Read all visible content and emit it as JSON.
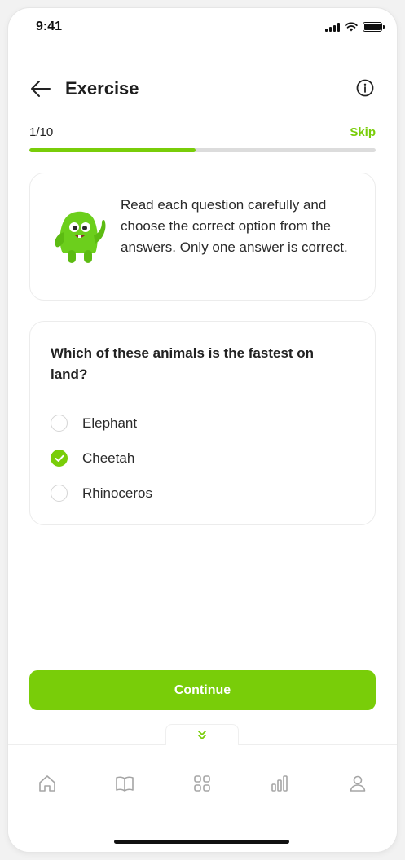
{
  "status_bar": {
    "time": "9:41"
  },
  "header": {
    "title": "Exercise"
  },
  "progress": {
    "count_text": "1/10",
    "skip_label": "Skip",
    "fraction": 0.48
  },
  "instruction": {
    "text": "Read each question carefully and choose the correct option from the answers. Only one answer is correct."
  },
  "question": {
    "text": "Which of these animals is the fastest on land?",
    "options": [
      {
        "label": "Elephant",
        "selected": false
      },
      {
        "label": "Cheetah",
        "selected": true
      },
      {
        "label": "Rhinoceros",
        "selected": false
      }
    ]
  },
  "continue_label": "Continue",
  "nav": {
    "items": [
      {
        "icon": "home-icon"
      },
      {
        "icon": "book-icon"
      },
      {
        "icon": "grid-icon"
      },
      {
        "icon": "bar-chart-icon"
      },
      {
        "icon": "user-icon"
      }
    ]
  },
  "colors": {
    "accent": "#79cd09",
    "track": "#dcdcdc",
    "icon_gray": "#a5a5a5"
  }
}
